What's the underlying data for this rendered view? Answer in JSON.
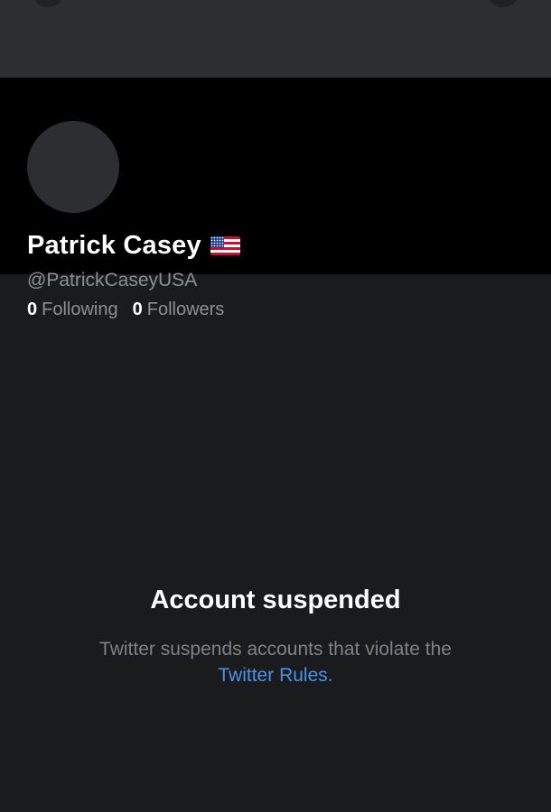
{
  "profile": {
    "display_name": "Patrick Casey",
    "flag_emoji": "🇺🇸",
    "handle": "@PatrickCaseyUSA",
    "following_count": "0",
    "following_label": "Following",
    "followers_count": "0",
    "followers_label": "Followers"
  },
  "suspension": {
    "title": "Account suspended",
    "message": "Twitter suspends accounts that violate the",
    "rules_link": "Twitter Rules",
    "period": "."
  },
  "colors": {
    "background": "#1a1b1d",
    "header_background": "#000000",
    "banner": "#2c2e31",
    "link": "#4d90e6",
    "secondary_text": "#8b9096"
  }
}
